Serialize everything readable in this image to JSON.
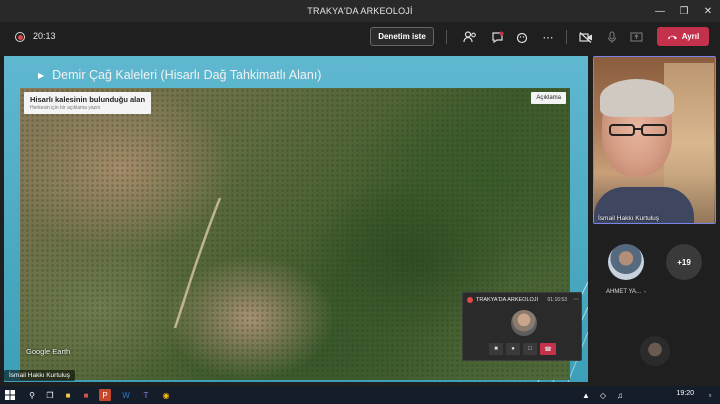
{
  "window": {
    "title": "TRAKYA'DA ARKEOLOJİ"
  },
  "toolbar": {
    "timer": "20:13",
    "help_label": "Denetim iste",
    "leave_label": "Ayrıl"
  },
  "slide": {
    "title": "Demir Çağ Kaleleri (Hisarlı Dağ Tahkimatlı Alanı)",
    "map_label_title": "Hisarlı kalesinin bulunduğu alan",
    "map_label_sub": "Herkesin için bir açıklama yazın",
    "map_desc_button": "Açıklama",
    "map_watermark": "Google Earth",
    "presenter_name": "İsmail Hakkı Kurtuluş"
  },
  "mini_window": {
    "title": "TRAKYA'DA ARKEOLOJİ",
    "time": "01:16:53"
  },
  "participants": {
    "video_name": "İsmail Hakkı Kurtuluş",
    "p1_name": "AHMET YA...",
    "more_count": "+19"
  },
  "taskbar": {
    "clock": "19:20"
  },
  "colors": {
    "accent": "#7b83eb",
    "leave": "#c4314b",
    "record": "#e0484d"
  }
}
